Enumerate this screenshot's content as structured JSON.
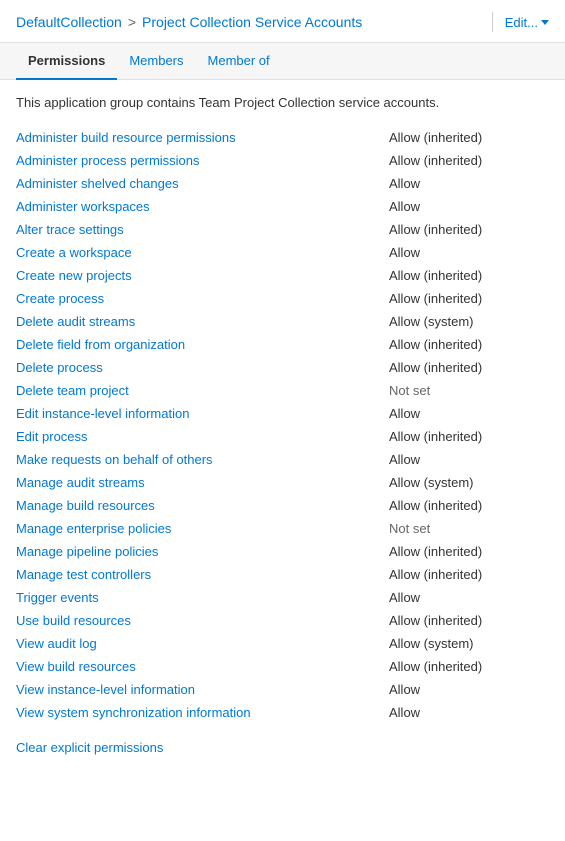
{
  "header": {
    "breadcrumb_link": "DefaultCollection",
    "breadcrumb_separator": ">",
    "breadcrumb_current": "Project Collection Service Accounts",
    "edit_label": "Edit...",
    "chevron_icon": "chevron-down"
  },
  "tabs": [
    {
      "id": "permissions",
      "label": "Permissions",
      "active": true
    },
    {
      "id": "members",
      "label": "Members",
      "active": false
    },
    {
      "id": "member-of",
      "label": "Member of",
      "active": false
    }
  ],
  "description": "This application group contains Team Project Collection service accounts.",
  "permissions": [
    {
      "name": "Administer build resource permissions",
      "value": "Allow (inherited)"
    },
    {
      "name": "Administer process permissions",
      "value": "Allow (inherited)"
    },
    {
      "name": "Administer shelved changes",
      "value": "Allow"
    },
    {
      "name": "Administer workspaces",
      "value": "Allow"
    },
    {
      "name": "Alter trace settings",
      "value": "Allow (inherited)"
    },
    {
      "name": "Create a workspace",
      "value": "Allow"
    },
    {
      "name": "Create new projects",
      "value": "Allow (inherited)"
    },
    {
      "name": "Create process",
      "value": "Allow (inherited)"
    },
    {
      "name": "Delete audit streams",
      "value": "Allow (system)"
    },
    {
      "name": "Delete field from organization",
      "value": "Allow (inherited)"
    },
    {
      "name": "Delete process",
      "value": "Allow (inherited)"
    },
    {
      "name": "Delete team project",
      "value": "Not set"
    },
    {
      "name": "Edit instance-level information",
      "value": "Allow"
    },
    {
      "name": "Edit process",
      "value": "Allow (inherited)"
    },
    {
      "name": "Make requests on behalf of others",
      "value": "Allow"
    },
    {
      "name": "Manage audit streams",
      "value": "Allow (system)"
    },
    {
      "name": "Manage build resources",
      "value": "Allow (inherited)"
    },
    {
      "name": "Manage enterprise policies",
      "value": "Not set"
    },
    {
      "name": "Manage pipeline policies",
      "value": "Allow (inherited)"
    },
    {
      "name": "Manage test controllers",
      "value": "Allow (inherited)"
    },
    {
      "name": "Trigger events",
      "value": "Allow"
    },
    {
      "name": "Use build resources",
      "value": "Allow (inherited)"
    },
    {
      "name": "View audit log",
      "value": "Allow (system)"
    },
    {
      "name": "View build resources",
      "value": "Allow (inherited)"
    },
    {
      "name": "View instance-level information",
      "value": "Allow"
    },
    {
      "name": "View system synchronization information",
      "value": "Allow"
    }
  ],
  "clear_permissions_label": "Clear explicit permissions"
}
